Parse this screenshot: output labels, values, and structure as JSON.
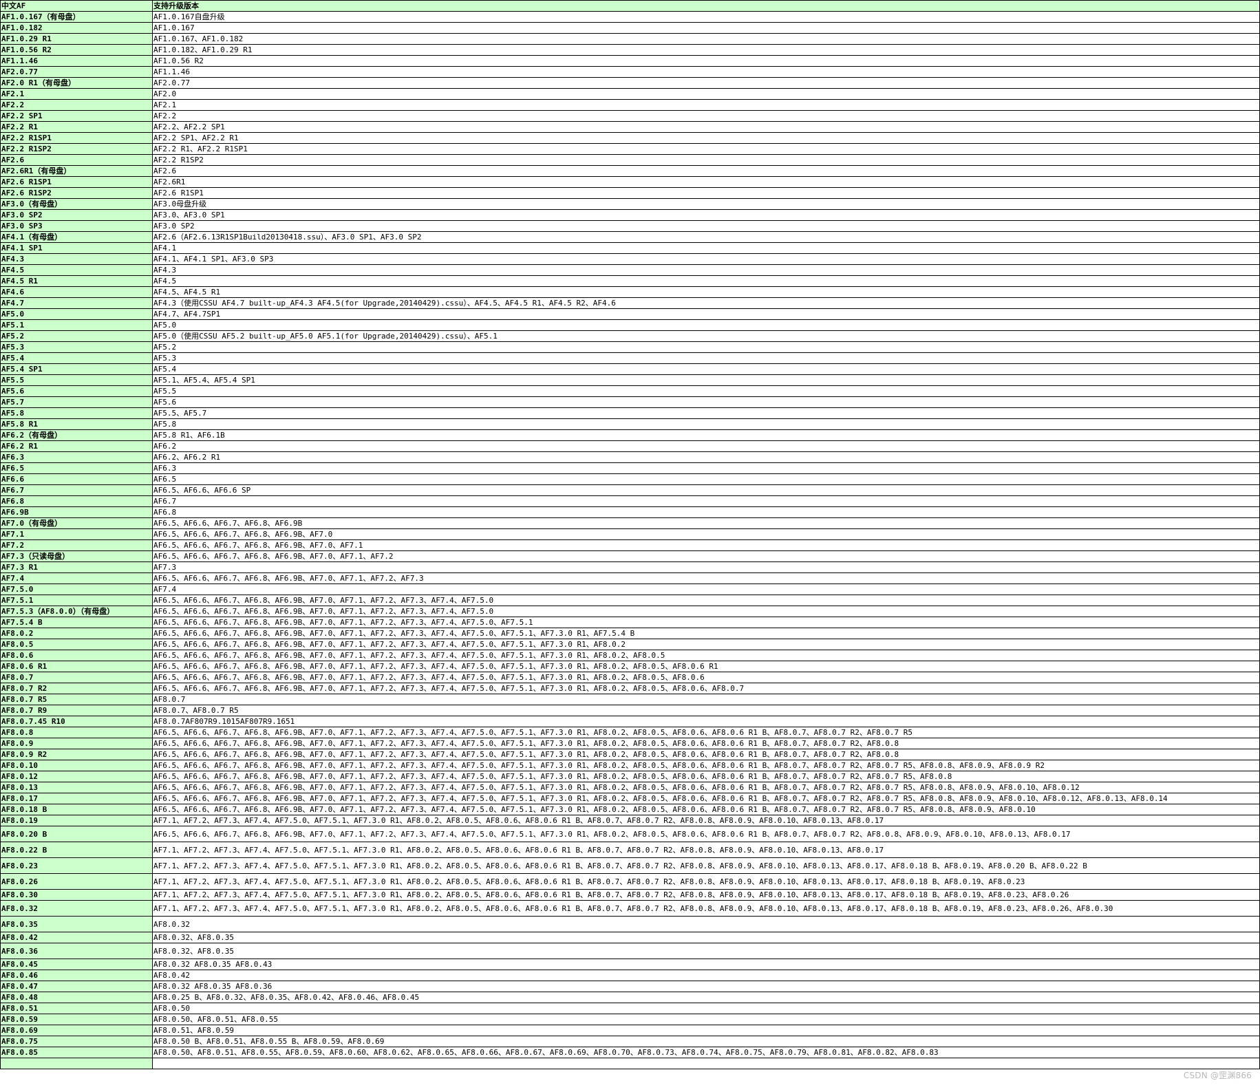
{
  "header": {
    "col1": "中文AF",
    "col2": "支持升级版本"
  },
  "rows": [
    {
      "version": "AF1.0.167（有母盘）",
      "supported": "AF1.0.167自盘升级"
    },
    {
      "version": "AF1.0.182",
      "supported": "AF1.0.167"
    },
    {
      "version": "AF1.0.29 R1",
      "supported": "AF1.0.167、AF1.0.182"
    },
    {
      "version": "AF1.0.56 R2",
      "supported": "AF1.0.182、AF1.0.29 R1"
    },
    {
      "version": "AF1.1.46",
      "supported": "AF1.0.56 R2"
    },
    {
      "version": "AF2.0.77",
      "supported": "AF1.1.46"
    },
    {
      "version": "AF2.0 R1（有母盘）",
      "supported": "AF2.0.77"
    },
    {
      "version": "AF2.1",
      "supported": "AF2.0"
    },
    {
      "version": "AF2.2",
      "supported": "AF2.1"
    },
    {
      "version": "AF2.2 SP1",
      "supported": "AF2.2"
    },
    {
      "version": "AF2.2 R1",
      "supported": "AF2.2、AF2.2 SP1"
    },
    {
      "version": "AF2.2 R1SP1",
      "supported": "AF2.2 SP1、AF2.2 R1"
    },
    {
      "version": "AF2.2 R1SP2",
      "supported": "AF2.2 R1、AF2.2 R1SP1"
    },
    {
      "version": "AF2.6",
      "supported": "AF2.2 R1SP2"
    },
    {
      "version": "AF2.6R1（有母盘）",
      "supported": "AF2.6"
    },
    {
      "version": "AF2.6 R1SP1",
      "supported": "AF2.6R1"
    },
    {
      "version": "AF2.6 R1SP2",
      "supported": "AF2.6 R1SP1"
    },
    {
      "version": "AF3.0（有母盘）",
      "supported": "AF3.0母盘升级"
    },
    {
      "version": "AF3.0 SP2",
      "supported": "AF3.0、AF3.0 SP1"
    },
    {
      "version": "AF3.0 SP3",
      "supported": "AF3.0 SP2"
    },
    {
      "version": "AF4.1（有母盘）",
      "supported": "AF2.6（AF2.6.13R1SP1Build20130418.ssu）、AF3.0 SP1、AF3.0 SP2"
    },
    {
      "version": "AF4.1 SP1",
      "supported": "AF4.1"
    },
    {
      "version": "AF4.3",
      "supported": "AF4.1、AF4.1 SP1、AF3.0 SP3"
    },
    {
      "version": "AF4.5",
      "supported": "AF4.3"
    },
    {
      "version": "AF4.5 R1",
      "supported": "AF4.5"
    },
    {
      "version": "AF4.6",
      "supported": "AF4.5、AF4.5 R1"
    },
    {
      "version": "AF4.7",
      "supported": "AF4.3（使用CSSU AF4.7 built-up_AF4.3 AF4.5(for Upgrade,20140429).cssu）、AF4.5、AF4.5 R1、AF4.5 R2、AF4.6"
    },
    {
      "version": "AF5.0",
      "supported": "AF4.7、AF4.7SP1"
    },
    {
      "version": "AF5.1",
      "supported": "AF5.0"
    },
    {
      "version": "AF5.2",
      "supported": "AF5.0（使用CSSU AF5.2 built-up_AF5.0 AF5.1(for Upgrade,20140429).cssu）、AF5.1"
    },
    {
      "version": "AF5.3",
      "supported": "AF5.2"
    },
    {
      "version": "AF5.4",
      "supported": "AF5.3"
    },
    {
      "version": "AF5.4 SP1",
      "supported": "AF5.4"
    },
    {
      "version": "AF5.5",
      "supported": "AF5.1、AF5.4、AF5.4 SP1"
    },
    {
      "version": "AF5.6",
      "supported": "AF5.5"
    },
    {
      "version": "AF5.7",
      "supported": "AF5.6"
    },
    {
      "version": "AF5.8",
      "supported": "AF5.5、AF5.7"
    },
    {
      "version": "AF5.8 R1",
      "supported": "AF5.8"
    },
    {
      "version": "AF6.2（有母盘）",
      "supported": "AF5.8 R1、AF6.1B"
    },
    {
      "version": "AF6.2 R1",
      "supported": "AF6.2"
    },
    {
      "version": "AF6.3",
      "supported": "AF6.2、AF6.2 R1"
    },
    {
      "version": "AF6.5",
      "supported": "AF6.3"
    },
    {
      "version": "AF6.6",
      "supported": "AF6.5"
    },
    {
      "version": "AF6.7",
      "supported": "AF6.5、AF6.6、AF6.6 SP"
    },
    {
      "version": "AF6.8",
      "supported": "AF6.7"
    },
    {
      "version": "AF6.9B",
      "supported": "AF6.8"
    },
    {
      "version": "AF7.0（有母盘）",
      "supported": "AF6.5、AF6.6、AF6.7、AF6.8、AF6.9B"
    },
    {
      "version": "AF7.1",
      "supported": "AF6.5、AF6.6、AF6.7、AF6.8、AF6.9B、AF7.0"
    },
    {
      "version": "AF7.2",
      "supported": "AF6.5、AF6.6、AF6.7、AF6.8、AF6.9B、AF7.0、AF7.1"
    },
    {
      "version": "AF7.3（只读母盘）",
      "supported": "AF6.5、AF6.6、AF6.7、AF6.8、AF6.9B、AF7.0、AF7.1、AF7.2"
    },
    {
      "version": "AF7.3 R1",
      "supported": "AF7.3"
    },
    {
      "version": "AF7.4",
      "supported": "AF6.5、AF6.6、AF6.7、AF6.8、AF6.9B、AF7.0、AF7.1、AF7.2、AF7.3"
    },
    {
      "version": "AF7.5.0",
      "supported": "AF7.4"
    },
    {
      "version": "AF7.5.1",
      "supported": "AF6.5、AF6.6、AF6.7、AF6.8、AF6.9B、AF7.0、AF7.1、AF7.2、AF7.3、AF7.4、AF7.5.0"
    },
    {
      "version": "AF7.5.3（AF8.0.0）（有母盘）",
      "supported": "AF6.5、AF6.6、AF6.7、AF6.8、AF6.9B、AF7.0、AF7.1、AF7.2、AF7.3、AF7.4、AF7.5.0"
    },
    {
      "version": "AF7.5.4 B",
      "supported": "AF6.5、AF6.6、AF6.7、AF6.8、AF6.9B、AF7.0、AF7.1、AF7.2、AF7.3、AF7.4、AF7.5.0、AF7.5.1"
    },
    {
      "version": "AF8.0.2",
      "supported": "AF6.5、AF6.6、AF6.7、AF6.8、AF6.9B、AF7.0、AF7.1、AF7.2、AF7.3、AF7.4、AF7.5.0、AF7.5.1、AF7.3.0 R1、AF7.5.4 B"
    },
    {
      "version": "AF8.0.5",
      "supported": "AF6.5、AF6.6、AF6.7、AF6.8、AF6.9B、AF7.0、AF7.1、AF7.2、AF7.3、AF7.4、AF7.5.0、AF7.5.1、AF7.3.0 R1、AF8.0.2"
    },
    {
      "version": "AF8.0.6",
      "supported": "AF6.5、AF6.6、AF6.7、AF6.8、AF6.9B、AF7.0、AF7.1、AF7.2、AF7.3、AF7.4、AF7.5.0、AF7.5.1、AF7.3.0 R1、AF8.0.2、AF8.0.5"
    },
    {
      "version": "AF8.0.6 R1",
      "supported": "AF6.5、AF6.6、AF6.7、AF6.8、AF6.9B、AF7.0、AF7.1、AF7.2、AF7.3、AF7.4、AF7.5.0、AF7.5.1、AF7.3.0 R1、AF8.0.2、AF8.0.5、AF8.0.6 R1"
    },
    {
      "version": "AF8.0.7",
      "supported": "AF6.5、AF6.6、AF6.7、AF6.8、AF6.9B、AF7.0、AF7.1、AF7.2、AF7.3、AF7.4、AF7.5.0、AF7.5.1、AF7.3.0 R1、AF8.0.2、AF8.0.5、AF8.0.6"
    },
    {
      "version": "AF8.0.7 R2",
      "supported": "AF6.5、AF6.6、AF6.7、AF6.8、AF6.9B、AF7.0、AF7.1、AF7.2、AF7.3、AF7.4、AF7.5.0、AF7.5.1、AF7.3.0 R1、AF8.0.2、AF8.0.5、AF8.0.6、AF8.0.7"
    },
    {
      "version": "AF8.0.7 R5",
      "supported": "AF8.0.7"
    },
    {
      "version": "AF8.0.7 R9",
      "supported": "AF8.0.7、AF8.0.7 R5"
    },
    {
      "version": "AF8.0.7.45 R10",
      "supported": "AF8.0.7AF807R9.1015AF807R9.1651"
    },
    {
      "version": "AF8.0.8",
      "supported": "AF6.5、AF6.6、AF6.7、AF6.8、AF6.9B、AF7.0、AF7.1、AF7.2、AF7.3、AF7.4、AF7.5.0、AF7.5.1、AF7.3.0 R1、AF8.0.2、AF8.0.5、AF8.0.6、AF8.0.6 R1 B、AF8.0.7、AF8.0.7 R2、AF8.0.7 R5"
    },
    {
      "version": "AF8.0.9",
      "supported": "AF6.5、AF6.6、AF6.7、AF6.8、AF6.9B、AF7.0、AF7.1、AF7.2、AF7.3、AF7.4、AF7.5.0、AF7.5.1、AF7.3.0 R1、AF8.0.2、AF8.0.5、AF8.0.6、AF8.0.6 R1 B、AF8.0.7、AF8.0.7 R2、AF8.0.8"
    },
    {
      "version": "AF8.0.9 R2",
      "supported": "AF6.5、AF6.6、AF6.7、AF6.8、AF6.9B、AF7.0、AF7.1、AF7.2、AF7.3、AF7.4、AF7.5.0、AF7.5.1、AF7.3.0 R1、AF8.0.2、AF8.0.5、AF8.0.6、AF8.0.6 R1 B、AF8.0.7、AF8.0.7 R2、AF8.0.8"
    },
    {
      "version": "AF8.0.10",
      "supported": "AF6.5、AF6.6、AF6.7、AF6.8、AF6.9B、AF7.0、AF7.1、AF7.2、AF7.3、AF7.4、AF7.5.0、AF7.5.1、AF7.3.0 R1、AF8.0.2、AF8.0.5、AF8.0.6、AF8.0.6 R1 B、AF8.0.7、AF8.0.7 R2、AF8.0.7 R5、AF8.0.8、AF8.0.9、AF8.0.9 R2"
    },
    {
      "version": "AF8.0.12",
      "supported": "AF6.5、AF6.6、AF6.7、AF6.8、AF6.9B、AF7.0、AF7.1、AF7.2、AF7.3、AF7.4、AF7.5.0、AF7.5.1、AF7.3.0 R1、AF8.0.2、AF8.0.5、AF8.0.6、AF8.0.6 R1 B、AF8.0.7、AF8.0.7 R2、AF8.0.7 R5、AF8.0.8"
    },
    {
      "version": "AF8.0.13",
      "supported": "AF6.5、AF6.6、AF6.7、AF6.8、AF6.9B、AF7.0、AF7.1、AF7.2、AF7.3、AF7.4、AF7.5.0、AF7.5.1、AF7.3.0 R1、AF8.0.2、AF8.0.5、AF8.0.6、AF8.0.6 R1 B、AF8.0.7、AF8.0.7 R2、AF8.0.7 R5、AF8.0.8、AF8.0.9、AF8.0.10、AF8.0.12"
    },
    {
      "version": "AF8.0.17",
      "supported": "AF6.5、AF6.6、AF6.7、AF6.8、AF6.9B、AF7.0、AF7.1、AF7.2、AF7.3、AF7.4、AF7.5.0、AF7.5.1、AF7.3.0 R1、AF8.0.2、AF8.0.5、AF8.0.6、AF8.0.6 R1 B、AF8.0.7、AF8.0.7 R2、AF8.0.7 R5、AF8.0.8、AF8.0.9、AF8.0.10、AF8.0.12、AF8.0.13、AF8.0.14"
    },
    {
      "version": "AF8.0.18 B",
      "supported": "AF6.5、AF6.6、AF6.7、AF6.8、AF6.9B、AF7.0、AF7.1、AF7.2、AF7.3、AF7.4、AF7.5.0、AF7.5.1、AF7.3.0 R1、AF8.0.2、AF8.0.5、AF8.0.6、AF8.0.6 R1 B、AF8.0.7、AF8.0.7 R2、AF8.0.7 R5、AF8.0.8、AF8.0.9、AF8.0.10"
    },
    {
      "version": "AF8.0.19",
      "supported": "AF7.1、AF7.2、AF7.3、AF7.4、AF7.5.0、AF7.5.1、AF7.3.0 R1、AF8.0.2、AF8.0.5、AF8.0.6、AF8.0.6 R1 B、AF8.0.7、AF8.0.7 R2、AF8.0.8、AF8.0.9、AF8.0.10、AF8.0.13、AF8.0.17"
    },
    {
      "version": "AF8.0.20 B",
      "supported": "AF6.5、AF6.6、AF6.7、AF6.8、AF6.9B、AF7.0、AF7.1、AF7.2、AF7.3、AF7.4、AF7.5.0、AF7.5.1、AF7.3.0 R1、AF8.0.2、AF8.0.5、AF8.0.6、AF8.0.6 R1 B、AF8.0.7、AF8.0.7 R2、AF8.0.8、AF8.0.9、AF8.0.10、AF8.0.13、AF8.0.17"
    },
    {
      "version": "AF8.0.22 B",
      "supported": "AF7.1、AF7.2、AF7.3、AF7.4、AF7.5.0、AF7.5.1、AF7.3.0 R1、AF8.0.2、AF8.0.5、AF8.0.6、AF8.0.6 R1 B、AF8.0.7、AF8.0.7 R2、AF8.0.8、AF8.0.9、AF8.0.10、AF8.0.13、AF8.0.17"
    },
    {
      "version": "AF8.0.23",
      "supported": "AF7.1、AF7.2、AF7.3、AF7.4、AF7.5.0、AF7.5.1、AF7.3.0 R1、AF8.0.2、AF8.0.5、AF8.0.6、AF8.0.6 R1 B、AF8.0.7、AF8.0.7 R2、AF8.0.8、AF8.0.9、AF8.0.10、AF8.0.13、AF8.0.17、AF8.0.18 B、AF8.0.19、AF8.0.20 B、AF8.0.22 B"
    },
    {
      "version": "AF8.0.26",
      "supported": "AF7.1、AF7.2、AF7.3、AF7.4、AF7.5.0、AF7.5.1、AF7.3.0 R1、AF8.0.2、AF8.0.5、AF8.0.6、AF8.0.6 R1 B、AF8.0.7、AF8.0.7 R2、AF8.0.8、AF8.0.9、AF8.0.10、AF8.0.13、AF8.0.17、AF8.0.18 B、AF8.0.19、AF8.0.23"
    },
    {
      "version": "AF8.0.30",
      "supported": "AF7.1、AF7.2、AF7.3、AF7.4、AF7.5.0、AF7.5.1、AF7.3.0 R1、AF8.0.2、AF8.0.5、AF8.0.6、AF8.0.6 R1 B、AF8.0.7、AF8.0.7 R2、AF8.0.8、AF8.0.9、AF8.0.10、AF8.0.13、AF8.0.17、AF8.0.18 B、AF8.0.19、AF8.0.23、AF8.0.26"
    },
    {
      "version": "AF8.0.32",
      "supported": "AF7.1、AF7.2、AF7.3、AF7.4、AF7.5.0、AF7.5.1、AF7.3.0 R1、AF8.0.2、AF8.0.5、AF8.0.6、AF8.0.6 R1 B、AF8.0.7、AF8.0.7 R2、AF8.0.8、AF8.0.9、AF8.0.10、AF8.0.13、AF8.0.17、AF8.0.18 B、AF8.0.19、AF8.0.23、AF8.0.26、AF8.0.30"
    },
    {
      "version": "AF8.0.35",
      "supported": "AF8.0.32"
    },
    {
      "version": "AF8.0.42",
      "supported": "AF8.0.32、AF8.0.35"
    },
    {
      "version": "AF8.0.36",
      "supported": "AF8.0.32、AF8.0.35"
    },
    {
      "version": "AF8.0.45",
      "supported": "AF8.0.32  AF8.0.35  AF8.0.43"
    },
    {
      "version": "AF8.0.46",
      "supported": "AF8.0.42"
    },
    {
      "version": "AF8.0.47",
      "supported": "AF8.0.32  AF8.0.35  AF8.0.36"
    },
    {
      "version": "AF8.0.48",
      "supported": "AF8.0.25 B、AF8.0.32、AF8.0.35、AF8.0.42、AF8.0.46、AF8.0.45"
    },
    {
      "version": "AF8.0.51",
      "supported": "AF8.0.50"
    },
    {
      "version": "AF8.0.59",
      "supported": "AF8.0.50、AF8.0.51、AF8.0.55"
    },
    {
      "version": "AF8.0.69",
      "supported": "AF8.0.51、AF8.0.59"
    },
    {
      "version": "AF8.0.75",
      "supported": "AF8.0.50 B、AF8.0.51、AF8.0.55 B、AF8.0.59、AF8.0.69"
    },
    {
      "version": "AF8.0.85",
      "supported": "AF8.0.50、AF8.0.51、AF8.0.55、AF8.0.59、AF8.0.60、AF8.0.62、AF8.0.65、AF8.0.66、AF8.0.67、AF8.0.69、AF8.0.70、AF8.0.73、AF8.0.74、AF8.0.75、AF8.0.79、AF8.0.81、AF8.0.82、AF8.0.83"
    },
    {
      "version": "",
      "supported": ""
    }
  ],
  "watermark": "CSDN @罡渊866"
}
